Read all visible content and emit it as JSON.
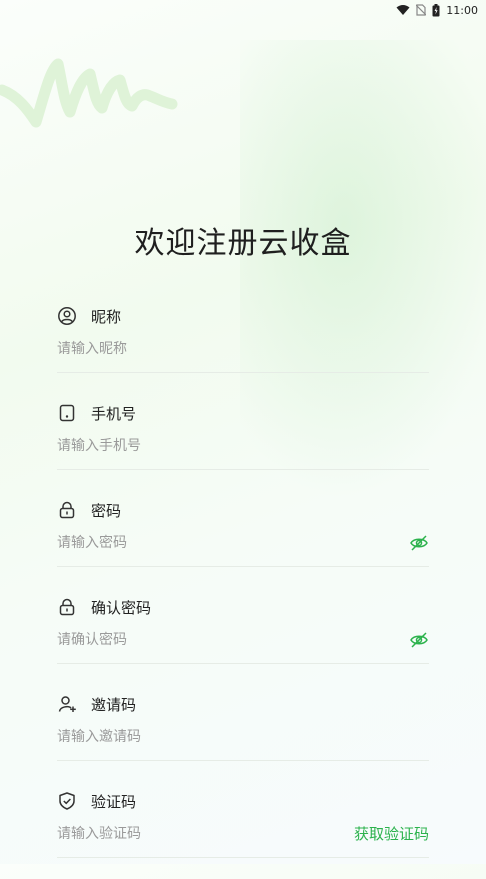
{
  "status_bar": {
    "time": "11:00"
  },
  "title": "欢迎注册云收盒",
  "fields": {
    "nickname": {
      "label": "昵称",
      "placeholder": "请输入昵称",
      "icon": "user-circle-icon"
    },
    "phone": {
      "label": "手机号",
      "placeholder": "请输入手机号",
      "icon": "phone-icon"
    },
    "password": {
      "label": "密码",
      "placeholder": "请输入密码",
      "icon": "lock-icon"
    },
    "confirm": {
      "label": "确认密码",
      "placeholder": "请确认密码",
      "icon": "lock-icon"
    },
    "invite": {
      "label": "邀请码",
      "placeholder": "请输入邀请码",
      "icon": "user-add-icon"
    },
    "code": {
      "label": "验证码",
      "placeholder": "请输入验证码",
      "icon": "shield-check-icon",
      "action": "获取验证码"
    }
  },
  "colors": {
    "accent": "#2bb24c",
    "decor": "#dcf3d6"
  }
}
